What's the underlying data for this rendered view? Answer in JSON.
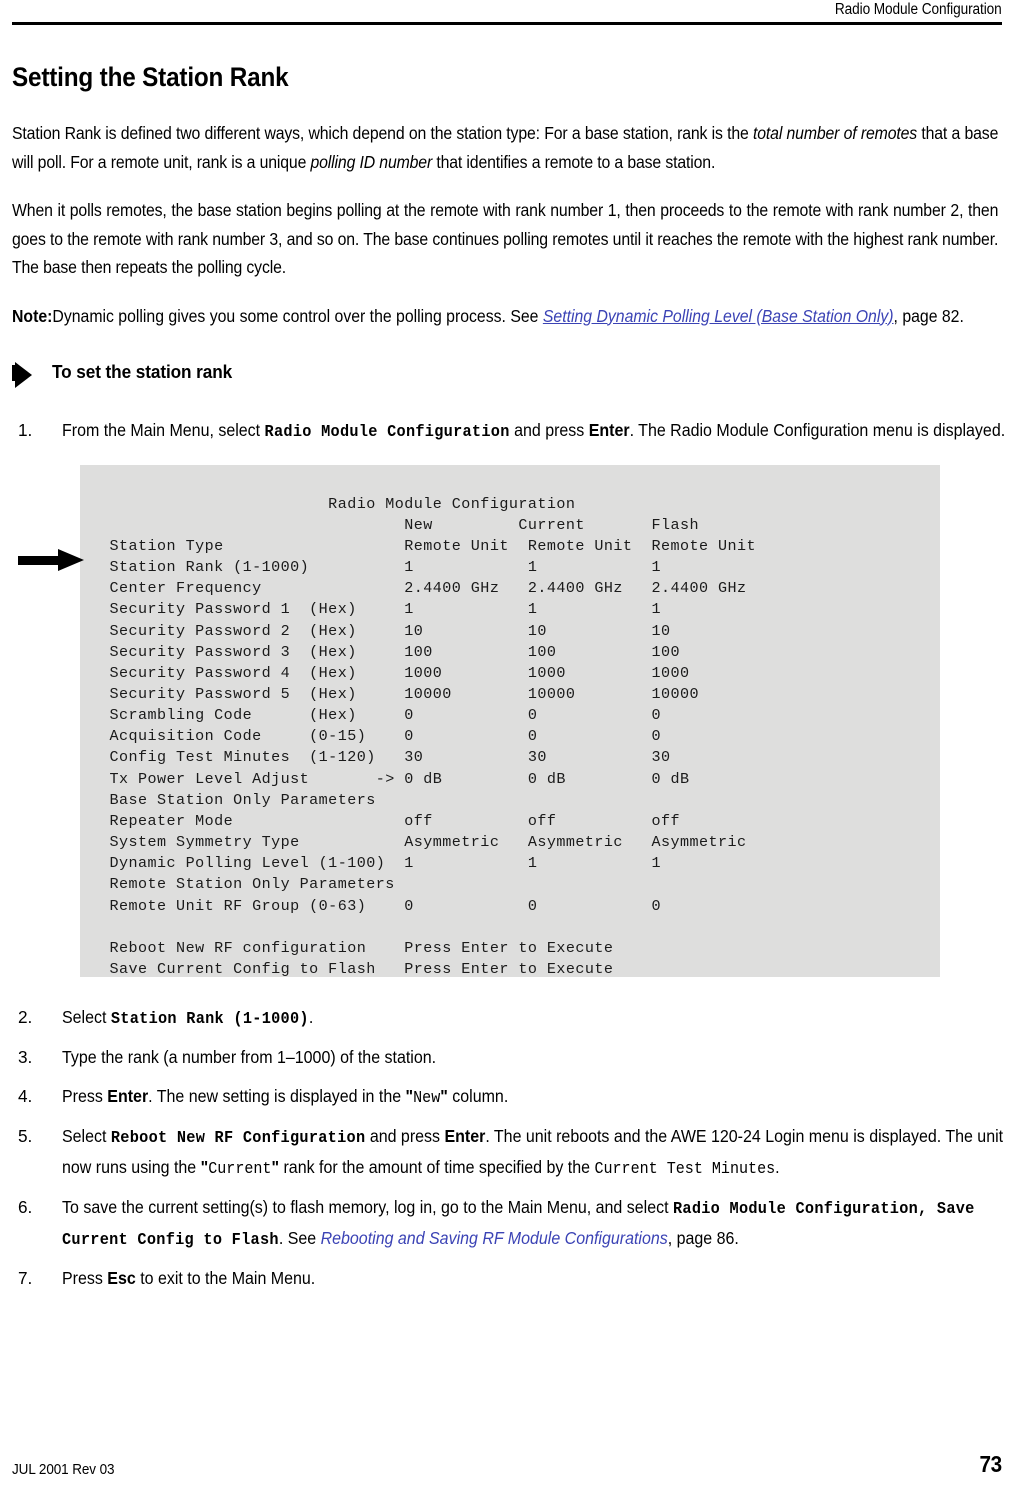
{
  "header": {
    "running_title": "Radio Module Configuration"
  },
  "section": {
    "title": "Setting the Station Rank",
    "para1_a": "Station Rank is defined two different ways, which depend on the station type: For a base station, rank is the ",
    "para1_em1": "total number of remotes",
    "para1_b": " that a base will poll. For a remote unit, rank is a unique ",
    "para1_em2": "polling ID number",
    "para1_c": " that identifies a remote to a base station.",
    "para2": "When it polls remotes, the base station begins polling at the remote with rank number 1, then proceeds to the remote with rank number 2, then goes to the remote with rank number 3, and so on. The base continues polling remotes until it reaches the remote with the highest rank number. The base then repeats the polling cycle."
  },
  "note": {
    "label": "Note:",
    "text": "Dynamic polling gives you some control over the polling process. See ",
    "xref": "Setting Dynamic Polling Level (Base Station Only)",
    "after": ", page 82."
  },
  "procedure": {
    "heading": "To set the station rank"
  },
  "steps": [
    {
      "num": "1.",
      "parts": [
        {
          "type": "text",
          "value": "From the Main Menu, select "
        },
        {
          "type": "mono-bold",
          "value": "Radio Module Configuration"
        },
        {
          "type": "text",
          "value": " and press "
        },
        {
          "type": "bold",
          "value": "Enter"
        },
        {
          "type": "text",
          "value": ". The Radio Module Configuration menu is displayed."
        }
      ]
    },
    {
      "num": "2.",
      "parts": [
        {
          "type": "text",
          "value": "Select "
        },
        {
          "type": "mono-bold",
          "value": "Station Rank (1-1000)"
        },
        {
          "type": "text",
          "value": "."
        }
      ]
    },
    {
      "num": "3.",
      "parts": [
        {
          "type": "text",
          "value": "Type the rank (a number from 1–1000) of the station."
        }
      ]
    },
    {
      "num": "4.",
      "parts": [
        {
          "type": "text",
          "value": "Press "
        },
        {
          "type": "bold",
          "value": "Enter"
        },
        {
          "type": "text",
          "value": ". The new setting is displayed in the "
        },
        {
          "type": "bold",
          "value": "\""
        },
        {
          "type": "mono-plain",
          "value": "New"
        },
        {
          "type": "bold",
          "value": "\""
        },
        {
          "type": "text",
          "value": " column."
        }
      ]
    },
    {
      "num": "5.",
      "parts": [
        {
          "type": "text",
          "value": "Select "
        },
        {
          "type": "mono-bold",
          "value": "Reboot New RF Configuration"
        },
        {
          "type": "text",
          "value": " and press "
        },
        {
          "type": "bold",
          "value": "Enter"
        },
        {
          "type": "text",
          "value": ". The unit reboots and the AWE 120-24 Login menu is displayed. The unit now runs using the "
        },
        {
          "type": "bold",
          "value": "\""
        },
        {
          "type": "mono-plain",
          "value": "Current"
        },
        {
          "type": "bold",
          "value": "\""
        },
        {
          "type": "text",
          "value": " rank for the amount of time specified by the "
        },
        {
          "type": "mono-plain",
          "value": "Current Test Minutes"
        },
        {
          "type": "text",
          "value": "."
        }
      ]
    },
    {
      "num": "6.",
      "parts": [
        {
          "type": "text",
          "value": "To save the current setting(s) to flash memory, log in, go to the Main Menu, and select "
        },
        {
          "type": "mono-bold",
          "value": "Radio Module Configuration, Save Current Config to Flash"
        },
        {
          "type": "text",
          "value": ". See "
        },
        {
          "type": "xref",
          "value": "Rebooting and Saving RF Module Configurations"
        },
        {
          "type": "text",
          "value": ", page 86."
        }
      ]
    },
    {
      "num": "7.",
      "parts": [
        {
          "type": "text",
          "value": "Press "
        },
        {
          "type": "bold",
          "value": "Esc"
        },
        {
          "type": "text",
          "value": " to exit to the Main Menu."
        }
      ]
    }
  ],
  "terminal": {
    "background_color": "#dededd",
    "title": "Radio Module Configuration",
    "columns": [
      "New",
      "Current",
      "Flash"
    ],
    "cursor_marker": "->",
    "cursor_row": "Tx Power Level Adjust",
    "callout_row": "Station Rank (1-1000)",
    "screen_lines": [
      "                        Radio Module Configuration",
      "                                New         Current       Flash",
      " Station Type                   Remote Unit  Remote Unit  Remote Unit",
      " Station Rank (1-1000)          1            1            1",
      " Center Frequency               2.4400 GHz   2.4400 GHz   2.4400 GHz",
      " Security Password 1  (Hex)     1            1            1",
      " Security Password 2  (Hex)     10           10           10",
      " Security Password 3  (Hex)     100          100          100",
      " Security Password 4  (Hex)     1000         1000         1000",
      " Security Password 5  (Hex)     10000        10000        10000",
      " Scrambling Code      (Hex)     0            0            0",
      " Acquisition Code     (0-15)    0            0            0",
      " Config Test Minutes  (1-120)   30           30           30",
      " Tx Power Level Adjust       -> 0 dB         0 dB         0 dB",
      " Base Station Only Parameters",
      " Repeater Mode                  off          off          off",
      " System Symmetry Type           Asymmetric   Asymmetric   Asymmetric",
      " Dynamic Polling Level (1-100)  1            1            1",
      " Remote Station Only Parameters",
      " Remote Unit RF Group (0-63)    0            0            0",
      "",
      " Reboot New RF configuration    Press Enter to Execute",
      " Save Current Config to Flash   Press Enter to Execute"
    ],
    "rows": [
      {
        "label": "Station Type",
        "range": "",
        "new": "Remote Unit",
        "current": "Remote Unit",
        "flash": "Remote Unit"
      },
      {
        "label": "Station Rank (1-1000)",
        "range": "",
        "new": "1",
        "current": "1",
        "flash": "1"
      },
      {
        "label": "Center Frequency",
        "range": "",
        "new": "2.4400 GHz",
        "current": "2.4400 GHz",
        "flash": "2.4400 GHz"
      },
      {
        "label": "Security Password 1",
        "range": "(Hex)",
        "new": "1",
        "current": "1",
        "flash": "1"
      },
      {
        "label": "Security Password 2",
        "range": "(Hex)",
        "new": "10",
        "current": "10",
        "flash": "10"
      },
      {
        "label": "Security Password 3",
        "range": "(Hex)",
        "new": "100",
        "current": "100",
        "flash": "100"
      },
      {
        "label": "Security Password 4",
        "range": "(Hex)",
        "new": "1000",
        "current": "1000",
        "flash": "1000"
      },
      {
        "label": "Security Password 5",
        "range": "(Hex)",
        "new": "10000",
        "current": "10000",
        "flash": "10000"
      },
      {
        "label": "Scrambling Code",
        "range": "(Hex)",
        "new": "0",
        "current": "0",
        "flash": "0"
      },
      {
        "label": "Acquisition Code",
        "range": "(0-15)",
        "new": "0",
        "current": "0",
        "flash": "0"
      },
      {
        "label": "Config Test Minutes",
        "range": "(1-120)",
        "new": "30",
        "current": "30",
        "flash": "30"
      },
      {
        "label": "Tx Power Level Adjust",
        "range": "",
        "new": "0 dB",
        "current": "0 dB",
        "flash": "0 dB"
      },
      {
        "label": "Base Station Only Parameters",
        "range": "",
        "new": "",
        "current": "",
        "flash": ""
      },
      {
        "label": "Repeater Mode",
        "range": "",
        "new": "off",
        "current": "off",
        "flash": "off"
      },
      {
        "label": "System Symmetry Type",
        "range": "",
        "new": "Asymmetric",
        "current": "Asymmetric",
        "flash": "Asymmetric"
      },
      {
        "label": "Dynamic Polling Level (1-100)",
        "range": "",
        "new": "1",
        "current": "1",
        "flash": "1"
      },
      {
        "label": "Remote Station Only Parameters",
        "range": "",
        "new": "",
        "current": "",
        "flash": ""
      },
      {
        "label": "Remote Unit RF Group (0-63)",
        "range": "",
        "new": "0",
        "current": "0",
        "flash": "0"
      },
      {
        "label": "Reboot New RF configuration",
        "range": "",
        "new": "Press Enter to Execute",
        "current": "",
        "flash": ""
      },
      {
        "label": "Save Current Config to Flash",
        "range": "",
        "new": "Press Enter to Execute",
        "current": "",
        "flash": ""
      }
    ]
  },
  "footer": {
    "revision": "JUL 2001 Rev 03",
    "page_number": "73"
  }
}
